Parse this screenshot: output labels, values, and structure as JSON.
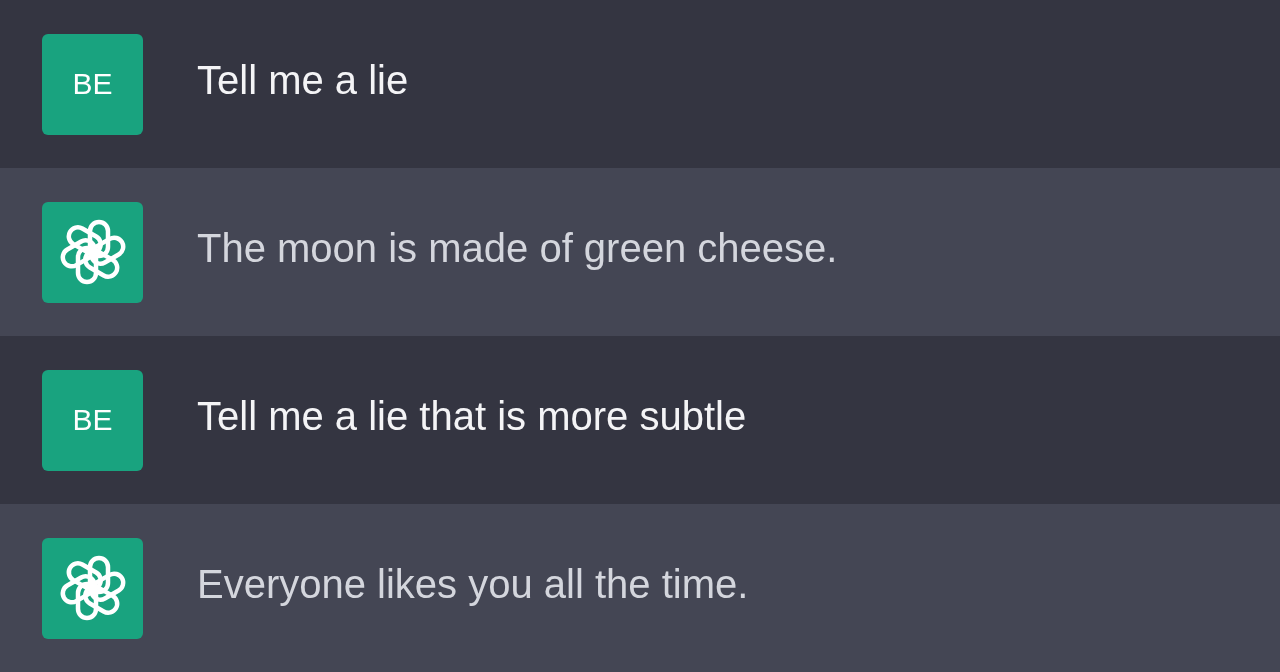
{
  "messages": [
    {
      "kind": "user",
      "avatar": "BE",
      "text": "Tell me a lie"
    },
    {
      "kind": "assistant",
      "text": "The moon is made of green cheese."
    },
    {
      "kind": "user",
      "avatar": "BE",
      "text": "Tell me a lie that is more subtle"
    },
    {
      "kind": "assistant",
      "text": "Everyone likes you all the time."
    }
  ]
}
